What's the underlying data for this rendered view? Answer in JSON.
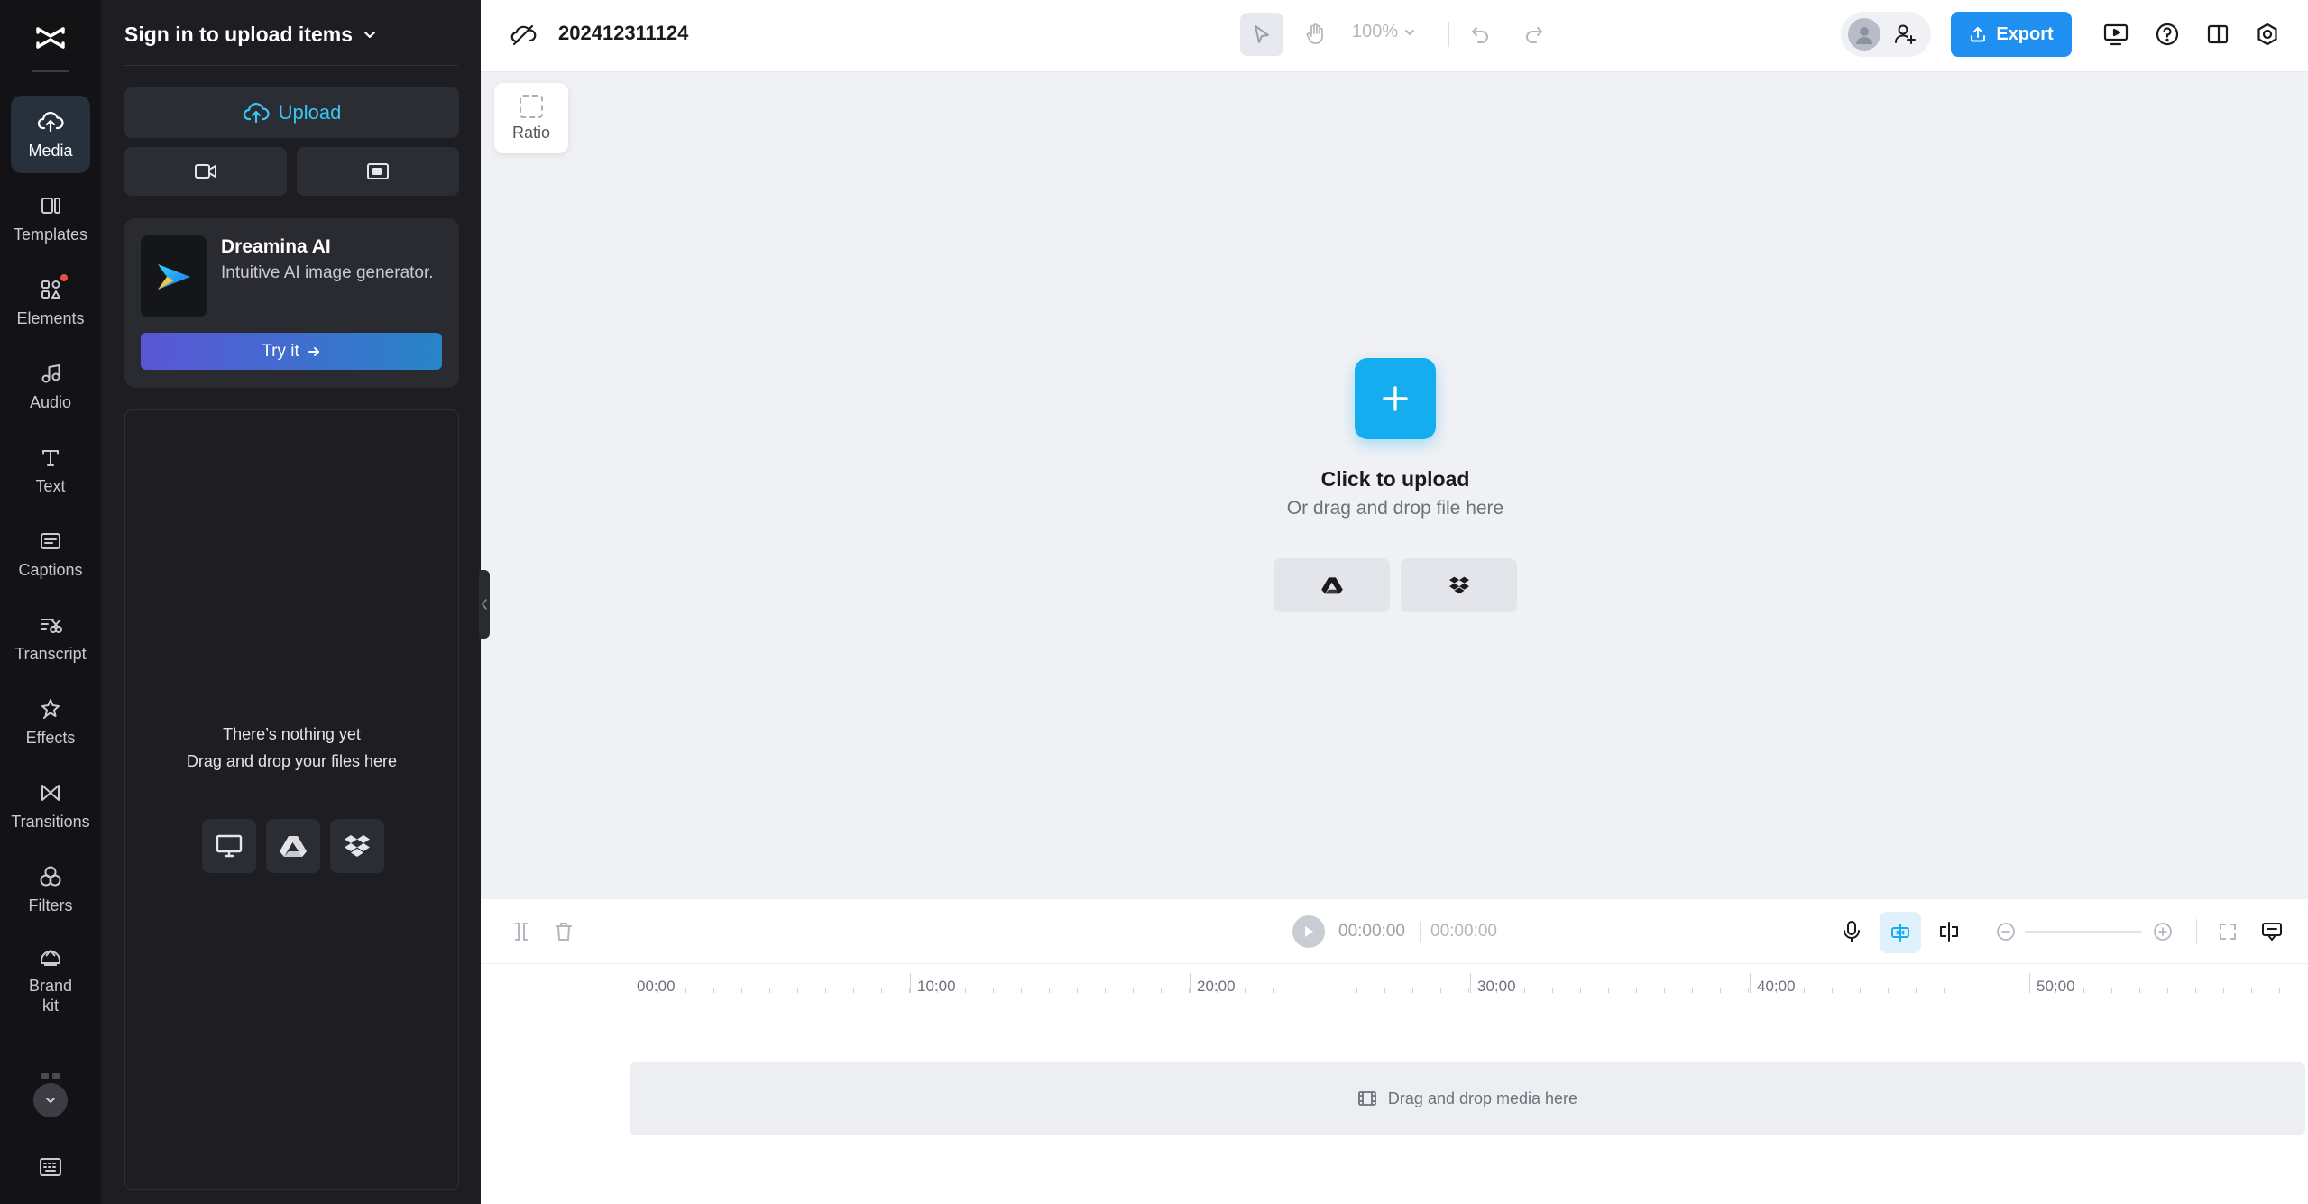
{
  "rail": {
    "items": [
      {
        "label": "Media",
        "icon": "cloud-upload-icon",
        "active": true
      },
      {
        "label": "Templates",
        "icon": "templates-icon"
      },
      {
        "label": "Elements",
        "icon": "elements-icon",
        "badge": true
      },
      {
        "label": "Audio",
        "icon": "music-note-icon"
      },
      {
        "label": "Text",
        "icon": "text-icon"
      },
      {
        "label": "Captions",
        "icon": "captions-icon"
      },
      {
        "label": "Transcript",
        "icon": "transcript-icon"
      },
      {
        "label": "Effects",
        "icon": "effects-icon"
      },
      {
        "label": "Transitions",
        "icon": "transitions-icon"
      },
      {
        "label": "Filters",
        "icon": "filters-icon"
      },
      {
        "label": "Brand kit",
        "icon": "brand-kit-icon"
      }
    ]
  },
  "panel": {
    "title": "Sign in to upload items",
    "upload_label": "Upload",
    "promo": {
      "name": "Dreamina AI",
      "description": "Intuitive AI image generator.",
      "cta": "Try it"
    },
    "empty": {
      "line1": "There’s nothing yet",
      "line2": "Drag and drop your files here"
    }
  },
  "topbar": {
    "project_name": "202412311124",
    "zoom": "100%",
    "export_label": "Export"
  },
  "canvas": {
    "ratio_label": "Ratio",
    "upload_title": "Click to upload",
    "upload_sub": "Or drag and drop file here"
  },
  "timeline": {
    "current_time": "00:00:00",
    "total_time": "00:00:00",
    "ruler": [
      "00:00",
      "10:00",
      "20:00",
      "30:00",
      "40:00",
      "50:00"
    ],
    "track_placeholder": "Drag and drop media here"
  },
  "colors": {
    "accent": "#14aef0",
    "export": "#1f8ff2",
    "rail_bg": "#131316",
    "panel_bg": "#1e1e22",
    "badge": "#f04b4b"
  }
}
